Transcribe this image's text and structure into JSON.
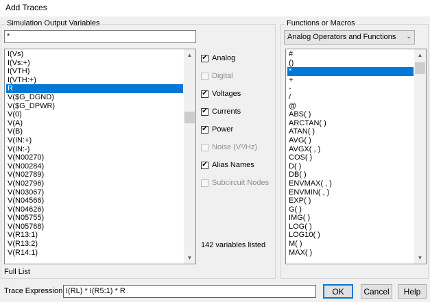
{
  "window": {
    "title": "Add Traces"
  },
  "sim_group": {
    "label": "Simulation Output Variables",
    "filter_value": "*"
  },
  "variables": [
    "I(Vs)",
    "I(Vs:+)",
    "I(VTH)",
    "I(VTH:+)",
    "R",
    "V($G_DGND)",
    "V($G_DPWR)",
    "V(0)",
    "V(A)",
    "V(B)",
    "V(IN:+)",
    "V(IN:-)",
    "V(N00270)",
    "V(N00284)",
    "V(N02789)",
    "V(N02796)",
    "V(N03067)",
    "V(N04566)",
    "V(N04626)",
    "V(N05755)",
    "V(N05768)",
    "V(R13:1)",
    "V(R13:2)",
    "V(R14:1)"
  ],
  "variables_selected": "R",
  "options": [
    {
      "label": "Analog",
      "checked": true,
      "enabled": true
    },
    {
      "label": "Digital",
      "checked": false,
      "enabled": false
    },
    {
      "label": "Voltages",
      "checked": true,
      "enabled": true
    },
    {
      "label": "Currents",
      "checked": true,
      "enabled": true
    },
    {
      "label": "Power",
      "checked": true,
      "enabled": true
    },
    {
      "label": "Noise (V²/Hz)",
      "checked": false,
      "enabled": false
    },
    {
      "label": "Alias Names",
      "checked": true,
      "enabled": true
    },
    {
      "label": "Subcircuit Nodes",
      "checked": false,
      "enabled": false
    }
  ],
  "count_text": "142 variables listed",
  "full_list_label": "Full List",
  "func_group": {
    "label": "Functions or Macros",
    "selected": "Analog Operators and Functions"
  },
  "functions": [
    "#",
    "()",
    "*",
    "+",
    "-",
    "/",
    "@",
    "ABS( )",
    "ARCTAN( )",
    "ATAN( )",
    "AVG( )",
    "AVGX( , )",
    "COS( )",
    "D( )",
    "DB( )",
    "ENVMAX( , )",
    "ENVMIN( , )",
    "EXP( )",
    "G( )",
    "IMG( )",
    "LOG( )",
    "LOG10( )",
    "M( )",
    "MAX( )"
  ],
  "functions_selected": "*",
  "trace": {
    "label": "Trace Expression:",
    "value": "I(RL) * I(R5:1) * R"
  },
  "buttons": {
    "ok": "OK",
    "cancel": "Cancel",
    "help": "Help"
  },
  "colors": {
    "selection": "#0078d7",
    "default_border": "#0078d7"
  }
}
